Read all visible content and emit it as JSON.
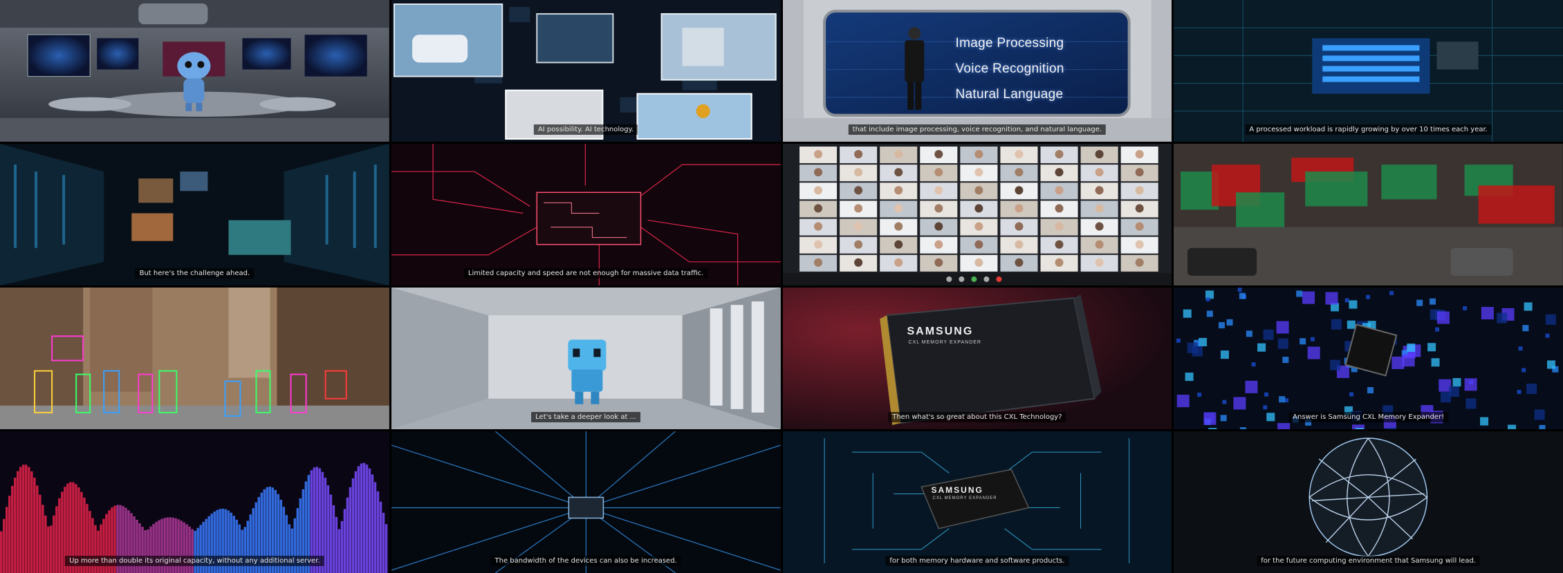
{
  "frames": [
    {
      "id": 1,
      "caption": ""
    },
    {
      "id": 2,
      "caption": "AI possibility. AI technology."
    },
    {
      "id": 3,
      "caption": "that include image processing, voice recognition, and natural language.",
      "screen_words": [
        "Image Processing",
        "Voice Recognition",
        "Natural Language"
      ]
    },
    {
      "id": 4,
      "caption": "A processed workload is rapidly growing by over 10 times each year."
    },
    {
      "id": 5,
      "caption": "But here's the challenge ahead."
    },
    {
      "id": 6,
      "caption": "Limited capacity and speed are not enough for massive data traffic."
    },
    {
      "id": 7,
      "caption": ""
    },
    {
      "id": 8,
      "caption": ""
    },
    {
      "id": 9,
      "caption": ""
    },
    {
      "id": 10,
      "caption": "Let's take a deeper look at ..."
    },
    {
      "id": 11,
      "caption": "Then what's so great about this CXL Technology?",
      "brand": "SAMSUNG",
      "brand_sub": "CXL MEMORY EXPANDER"
    },
    {
      "id": 12,
      "caption": "Answer is Samsung CXL Memory Expander!"
    },
    {
      "id": 13,
      "caption": "Up more than double its original capacity, without any additional server."
    },
    {
      "id": 14,
      "caption": "The bandwidth of the devices can also be increased."
    },
    {
      "id": 15,
      "caption": "for both memory hardware and software products.",
      "brand": "SAMSUNG",
      "brand_sub": "CXL MEMORY EXPANDER"
    },
    {
      "id": 16,
      "caption": "for the future computing environment that Samsung will lead."
    }
  ],
  "colors": {
    "background": "#000000",
    "caption_bg": "rgba(0,0,0,0.62)",
    "accent_blue": "#2f7bff",
    "accent_red": "#ff2a55"
  }
}
